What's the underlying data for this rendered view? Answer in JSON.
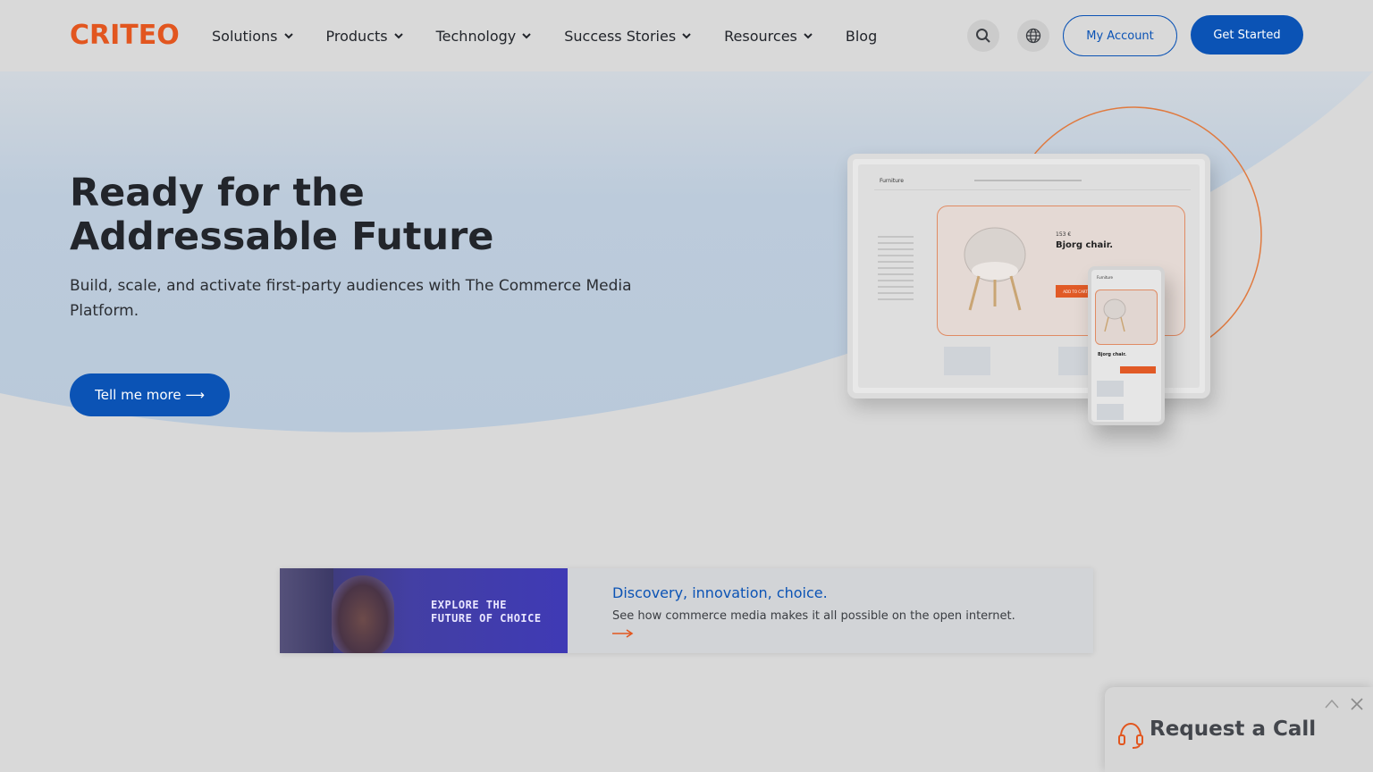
{
  "header": {
    "logo": "CRITEO",
    "nav": [
      {
        "label": "Solutions",
        "has_dropdown": true
      },
      {
        "label": "Products",
        "has_dropdown": true
      },
      {
        "label": "Technology",
        "has_dropdown": true
      },
      {
        "label": "Success Stories",
        "has_dropdown": true
      },
      {
        "label": "Resources",
        "has_dropdown": true
      },
      {
        "label": "Blog",
        "has_dropdown": false
      }
    ],
    "search_icon": "search-icon",
    "language_icon": "globe-icon",
    "my_account_label": "My Account",
    "get_started_label": "Get Started"
  },
  "hero": {
    "title": "Ready for the Addressable Future",
    "subtitle": "Build, scale, and activate first-party audiences with The Commerce Media Platform.",
    "cta_label": "Tell me more ⟶",
    "mockup": {
      "tablet_title": "Furniture",
      "price": "153 €",
      "product_name": "Bjorg chair.",
      "add_to_cart": "ADD TO CART",
      "phone_title": "Furniture",
      "phone_product_name": "Bjorg chair."
    }
  },
  "promo": {
    "image_text": "EXPLORE THE\nFUTURE OF CHOICE",
    "title": "Discovery, innovation, choice.",
    "description": "See how commerce media makes it all possible on the open internet.",
    "arrow_icon": "arrow-right-icon"
  },
  "request_call": {
    "label": "Request a Call",
    "icon": "headset-icon",
    "minimize_icon": "chevron-up-icon",
    "close_icon": "close-icon"
  },
  "colors": {
    "brand_orange": "#e2561f",
    "brand_blue": "#0b53b5",
    "wave_blue": "#bccbdb",
    "background": "#d9d9d9"
  }
}
